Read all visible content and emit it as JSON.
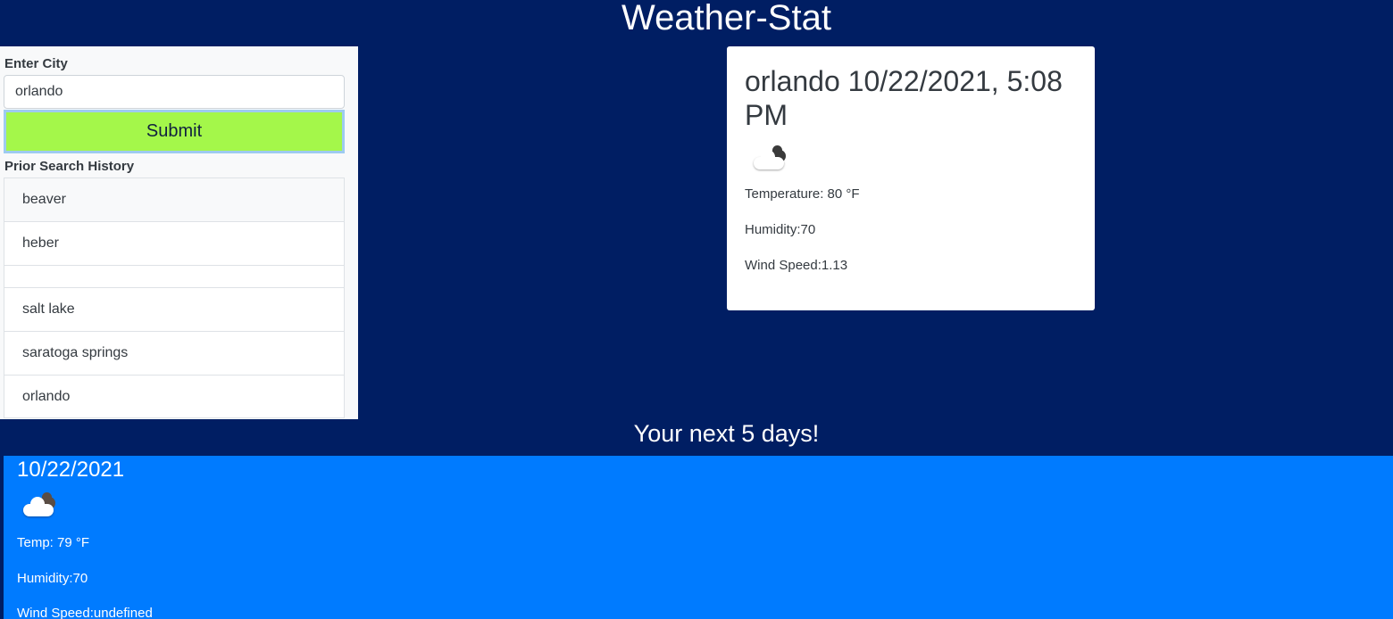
{
  "app": {
    "title": "Weather-Stat"
  },
  "search": {
    "label": "Enter City",
    "value": "orlando",
    "submit_label": "Submit"
  },
  "history": {
    "label": "Prior Search History",
    "items": [
      "beaver",
      "heber",
      "",
      "salt lake",
      "saratoga springs",
      "orlando"
    ]
  },
  "current": {
    "title": "orlando 10/22/2021, 5:08 PM",
    "icon": "partly-cloudy-icon",
    "temperature": "Temperature: 80 °F",
    "humidity": "Humidity:70",
    "wind": "Wind Speed:1.13"
  },
  "forecast": {
    "heading": "Your next 5 days!",
    "days": [
      {
        "date": "10/22/2021",
        "icon": "partly-cloudy-icon",
        "temp": "Temp: 79 °F",
        "humidity": "Humidity:70",
        "wind": "Wind Speed:undefined"
      }
    ]
  },
  "colors": {
    "background": "#001e63",
    "submit": "#a4f74a",
    "forecast_panel": "#007bff"
  }
}
